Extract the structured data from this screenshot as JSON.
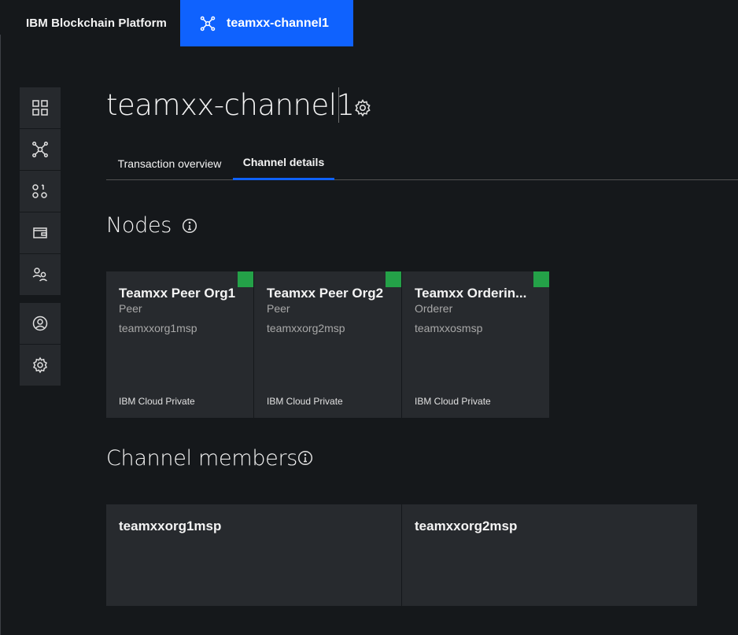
{
  "header": {
    "brand": "IBM Blockchain Platform",
    "active_tab": "teamxx-channel1"
  },
  "sidenav": {
    "items": [
      {
        "name": "dashboard",
        "icon": "grid-icon"
      },
      {
        "name": "channels",
        "icon": "network-icon"
      },
      {
        "name": "smart-contracts",
        "icon": "binary-icon"
      },
      {
        "name": "wallet",
        "icon": "wallet-icon"
      },
      {
        "name": "users",
        "icon": "users-icon"
      },
      {
        "name": "profile",
        "icon": "user-avatar-icon"
      },
      {
        "name": "settings",
        "icon": "gear-icon"
      }
    ]
  },
  "page": {
    "title": "teamxx-channel1",
    "tabs": [
      {
        "label": "Transaction overview",
        "active": false
      },
      {
        "label": "Channel details",
        "active": true
      }
    ]
  },
  "nodes": {
    "heading": "Nodes",
    "status_color": "#24a148",
    "items": [
      {
        "name": "Teamxx Peer Org1",
        "type": "Peer",
        "msp": "teamxxorg1msp",
        "location": "IBM Cloud Private"
      },
      {
        "name": "Teamxx Peer Org2",
        "type": "Peer",
        "msp": "teamxxorg2msp",
        "location": "IBM Cloud Private"
      },
      {
        "name": "Teamxx Orderin...",
        "type": "Orderer",
        "msp": "teamxxosmsp",
        "location": "IBM Cloud Private"
      }
    ]
  },
  "members": {
    "heading": "Channel members",
    "items": [
      {
        "name": "teamxxorg1msp"
      },
      {
        "name": "teamxxorg2msp"
      }
    ]
  },
  "colors": {
    "accent": "#0f62fe",
    "background": "#15181b",
    "card": "#272a2e"
  }
}
